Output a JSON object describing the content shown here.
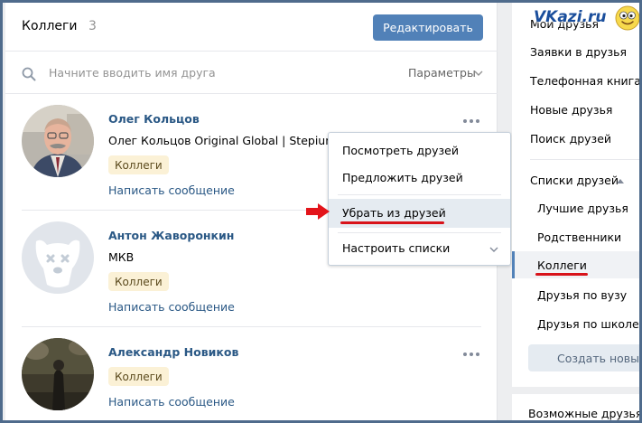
{
  "header": {
    "title": "Коллеги",
    "count": "3",
    "edit_button": "Редактировать"
  },
  "search": {
    "placeholder": "Начните вводить имя друга",
    "params": "Параметры"
  },
  "friends": [
    {
      "name": "Олег Кольцов",
      "subtitle": "Олег Кольцов Original Global | Stepium",
      "tag": "Коллеги",
      "message": "Написать сообщение"
    },
    {
      "name": "Антон Жаворонкин",
      "subtitle": "МКВ",
      "tag": "Коллеги",
      "message": "Написать сообщение"
    },
    {
      "name": "Александр Новиков",
      "subtitle": "",
      "tag": "Коллеги",
      "message": "Написать сообщение"
    }
  ],
  "menu": {
    "items": [
      "Посмотреть друзей",
      "Предложить друзей",
      "Убрать из друзей",
      "Настроить списки"
    ],
    "highlighted": "Убрать из друзей"
  },
  "nav": {
    "items": [
      "Мои друзья",
      "Заявки в друзья",
      "Телефонная книга",
      "Новые друзья",
      "Поиск друзей"
    ],
    "lists_header": "Списки друзей",
    "lists": [
      "Лучшие друзья",
      "Родственники",
      "Коллеги",
      "Друзья по вузу",
      "Друзья по школе"
    ],
    "active": "Коллеги",
    "create_button": "Создать новый",
    "bottom": "Возможные друзья"
  },
  "watermark": "VKazi.ru",
  "colors": {
    "accent": "#5181b8",
    "link": "#2a5885",
    "tag_bg": "#fbf1d6",
    "annotation": "#d8131a"
  },
  "icons": {
    "search": "search-icon",
    "more": "more-dots-icon",
    "chevron": "chevron-down-icon",
    "arrow": "arrow-right-icon"
  }
}
